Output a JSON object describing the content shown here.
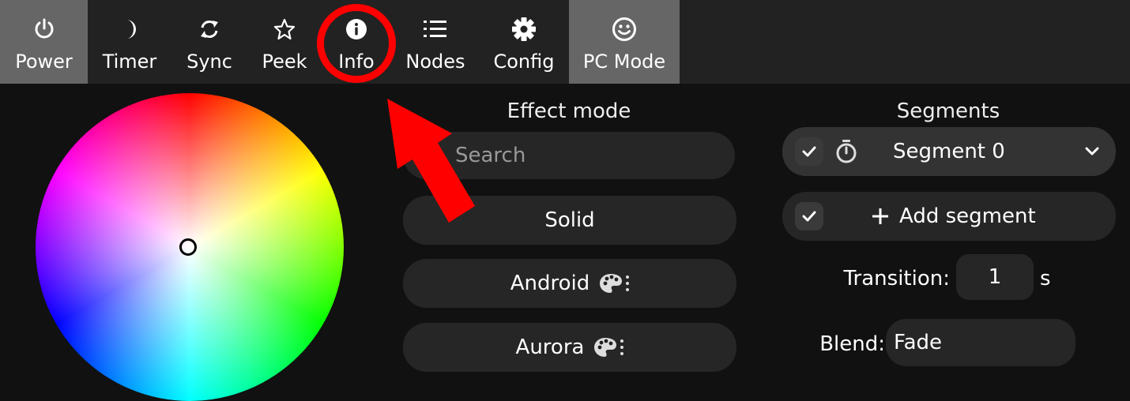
{
  "nav": {
    "tabs": [
      {
        "label": "Power",
        "icon": "power-icon",
        "active": true
      },
      {
        "label": "Timer",
        "icon": "moon-icon",
        "active": false
      },
      {
        "label": "Sync",
        "icon": "sync-icon",
        "active": false
      },
      {
        "label": "Peek",
        "icon": "star-icon",
        "active": false
      },
      {
        "label": "Info",
        "icon": "info-icon",
        "active": false
      },
      {
        "label": "Nodes",
        "icon": "list-icon",
        "active": false
      },
      {
        "label": "Config",
        "icon": "gear-icon",
        "active": false
      },
      {
        "label": "PC Mode",
        "icon": "smiley-icon",
        "active": true
      }
    ]
  },
  "effects": {
    "heading": "Effect mode",
    "search_placeholder": "Search",
    "items": [
      {
        "label": "Solid",
        "palette": false
      },
      {
        "label": "Android",
        "palette": true
      },
      {
        "label": "Aurora",
        "palette": true
      }
    ]
  },
  "segments": {
    "heading": "Segments",
    "segment_label": "Segment 0",
    "add_label": "Add segment",
    "transition_label": "Transition:",
    "transition_value": "1",
    "transition_unit": "s",
    "blend_label": "Blend:",
    "blend_value": "Fade"
  },
  "colors": {
    "annotation": "#ff0000",
    "active_tab": "#666666",
    "bar": "#222222",
    "pill": "#262626"
  }
}
